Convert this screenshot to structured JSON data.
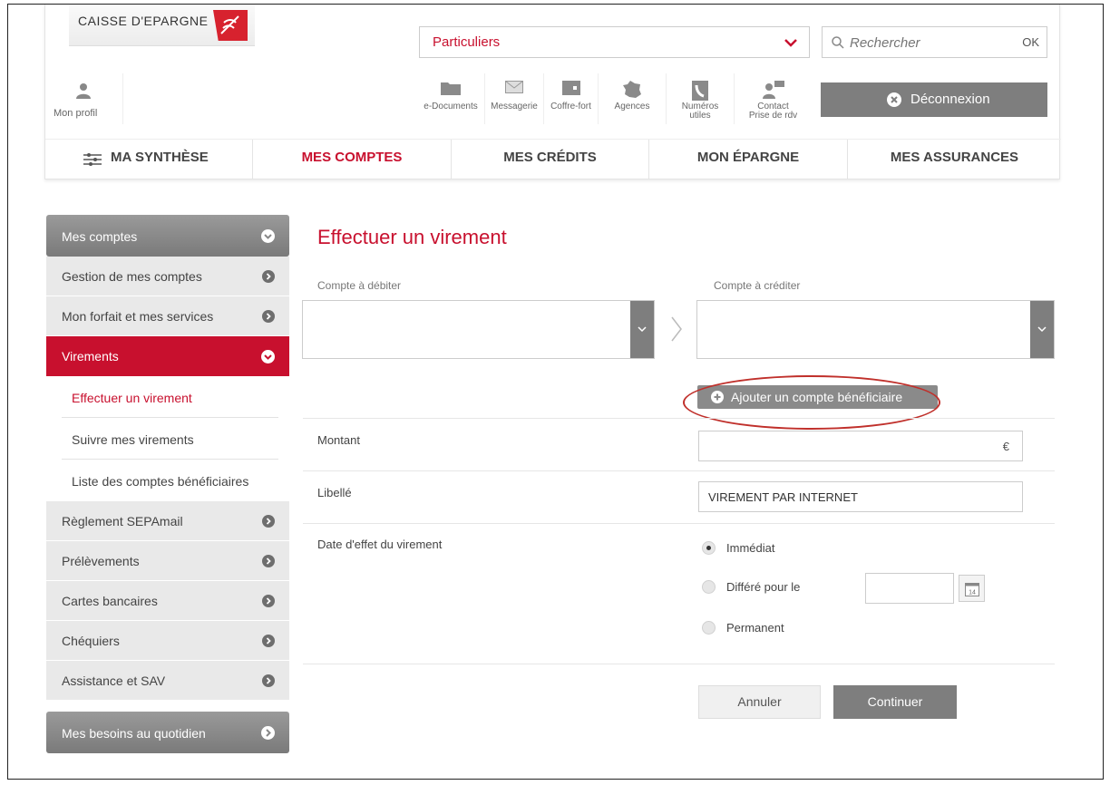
{
  "brand": {
    "name": "CAISSE D'EPARGNE"
  },
  "header": {
    "segment_select": {
      "value": "Particuliers"
    },
    "search": {
      "placeholder": "Rechercher",
      "submit_label": "OK"
    },
    "profile_label": "Mon profil",
    "tools": [
      {
        "label": "e-Documents",
        "icon": "folder-icon"
      },
      {
        "label": "Messagerie",
        "icon": "envelope-icon"
      },
      {
        "label": "Coffre-fort",
        "icon": "safe-icon"
      },
      {
        "label": "Agences",
        "icon": "france-map-icon"
      },
      {
        "label_line1": "Numéros",
        "label_line2": "utiles",
        "icon": "phone-icon"
      },
      {
        "label_line1": "Contact",
        "label_line2": "Prise de rdv",
        "icon": "advisor-icon"
      }
    ],
    "logout_label": "Déconnexion"
  },
  "main_nav": [
    {
      "label": "MA SYNTHÈSE",
      "icon": "sliders-icon",
      "active": false
    },
    {
      "label": "MES COMPTES",
      "active": true
    },
    {
      "label": "MES CRÉDITS",
      "active": false
    },
    {
      "label": "MON ÉPARGNE",
      "active": false
    },
    {
      "label": "MES ASSURANCES",
      "active": false
    }
  ],
  "sidebar": {
    "section_title": "Mes comptes",
    "items": [
      {
        "label": "Gestion de mes comptes"
      },
      {
        "label": "Mon forfait et mes services"
      },
      {
        "label": "Virements",
        "active": true
      },
      {
        "label": "Règlement SEPAmail"
      },
      {
        "label": "Prélèvements"
      },
      {
        "label": "Cartes bancaires"
      },
      {
        "label": "Chéquiers"
      },
      {
        "label": "Assistance et SAV"
      }
    ],
    "sub_items": [
      {
        "label": "Effectuer un virement",
        "current": true
      },
      {
        "label": "Suivre mes virements"
      },
      {
        "label": "Liste des comptes bénéficiaires"
      }
    ],
    "footer_section": "Mes besoins au quotidien"
  },
  "form": {
    "title": "Effectuer un virement",
    "debit_label": "Compte à débiter",
    "credit_label": "Compte à créditer",
    "add_beneficiary_label": "Ajouter un compte bénéficiaire",
    "amount_label": "Montant",
    "amount_value": "",
    "currency": "€",
    "libelle_label": "Libellé",
    "libelle_value": "VIREMENT PAR INTERNET",
    "date_label": "Date d'effet du virement",
    "options": [
      {
        "label": "Immédiat",
        "selected": true
      },
      {
        "label": "Différé pour le",
        "selected": false
      },
      {
        "label": "Permanent",
        "selected": false
      }
    ],
    "calendar_icon_text": "14",
    "cancel_label": "Annuler",
    "continue_label": "Continuer"
  },
  "colors": {
    "accent": "#c8102e",
    "grey_button": "#7e7e7e",
    "highlight_ring": "#c0302b"
  }
}
